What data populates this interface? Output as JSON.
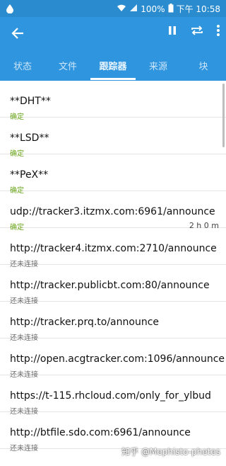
{
  "status_bar": {
    "battery": "100%",
    "time": "下午 10:58",
    "icons": [
      "water-drop-icon",
      "wifi-icon",
      "signal-icon",
      "battery-icon"
    ]
  },
  "toolbar": {
    "back_icon": "arrow-back-icon",
    "pause_icon": "pause-icon",
    "repeat_icon": "repeat-icon",
    "more_icon": "more-vert-icon"
  },
  "tabs": [
    "状态",
    "文件",
    "跟踪器",
    "来源",
    "块"
  ],
  "active_tab": "跟踪器",
  "trackers": [
    {
      "url": "**DHT**",
      "status": "确定",
      "ok": true,
      "time": ""
    },
    {
      "url": "**LSD**",
      "status": "确定",
      "ok": true,
      "time": ""
    },
    {
      "url": "**PeX**",
      "status": "确定",
      "ok": true,
      "time": ""
    },
    {
      "url": "udp://tracker3.itzmx.com:6961/announce",
      "status": "确定",
      "ok": true,
      "time": "2 h 0 m"
    },
    {
      "url": "http://tracker4.itzmx.com:2710/announce",
      "status": "还未连接",
      "ok": false,
      "time": ""
    },
    {
      "url": "http://tracker.publicbt.com:80/announce",
      "status": "还未连接",
      "ok": false,
      "time": ""
    },
    {
      "url": "http://tracker.prq.to/announce",
      "status": "还未连接",
      "ok": false,
      "time": ""
    },
    {
      "url": "http://open.acgtracker.com:1096/announce",
      "status": "还未连接",
      "ok": false,
      "time": ""
    },
    {
      "url": "https://t-115.rhcloud.com/only_for_ylbud",
      "status": "还未连接",
      "ok": false,
      "time": ""
    },
    {
      "url": "http://btfile.sdo.com:6961/announce",
      "status": "还未连接",
      "ok": false,
      "time": ""
    }
  ],
  "watermark": "知乎 @Mephisto-phetes",
  "colors": {
    "primary": "#2f95de",
    "status_bar": "#2a8ccf",
    "ok_green": "#6aa51a"
  }
}
